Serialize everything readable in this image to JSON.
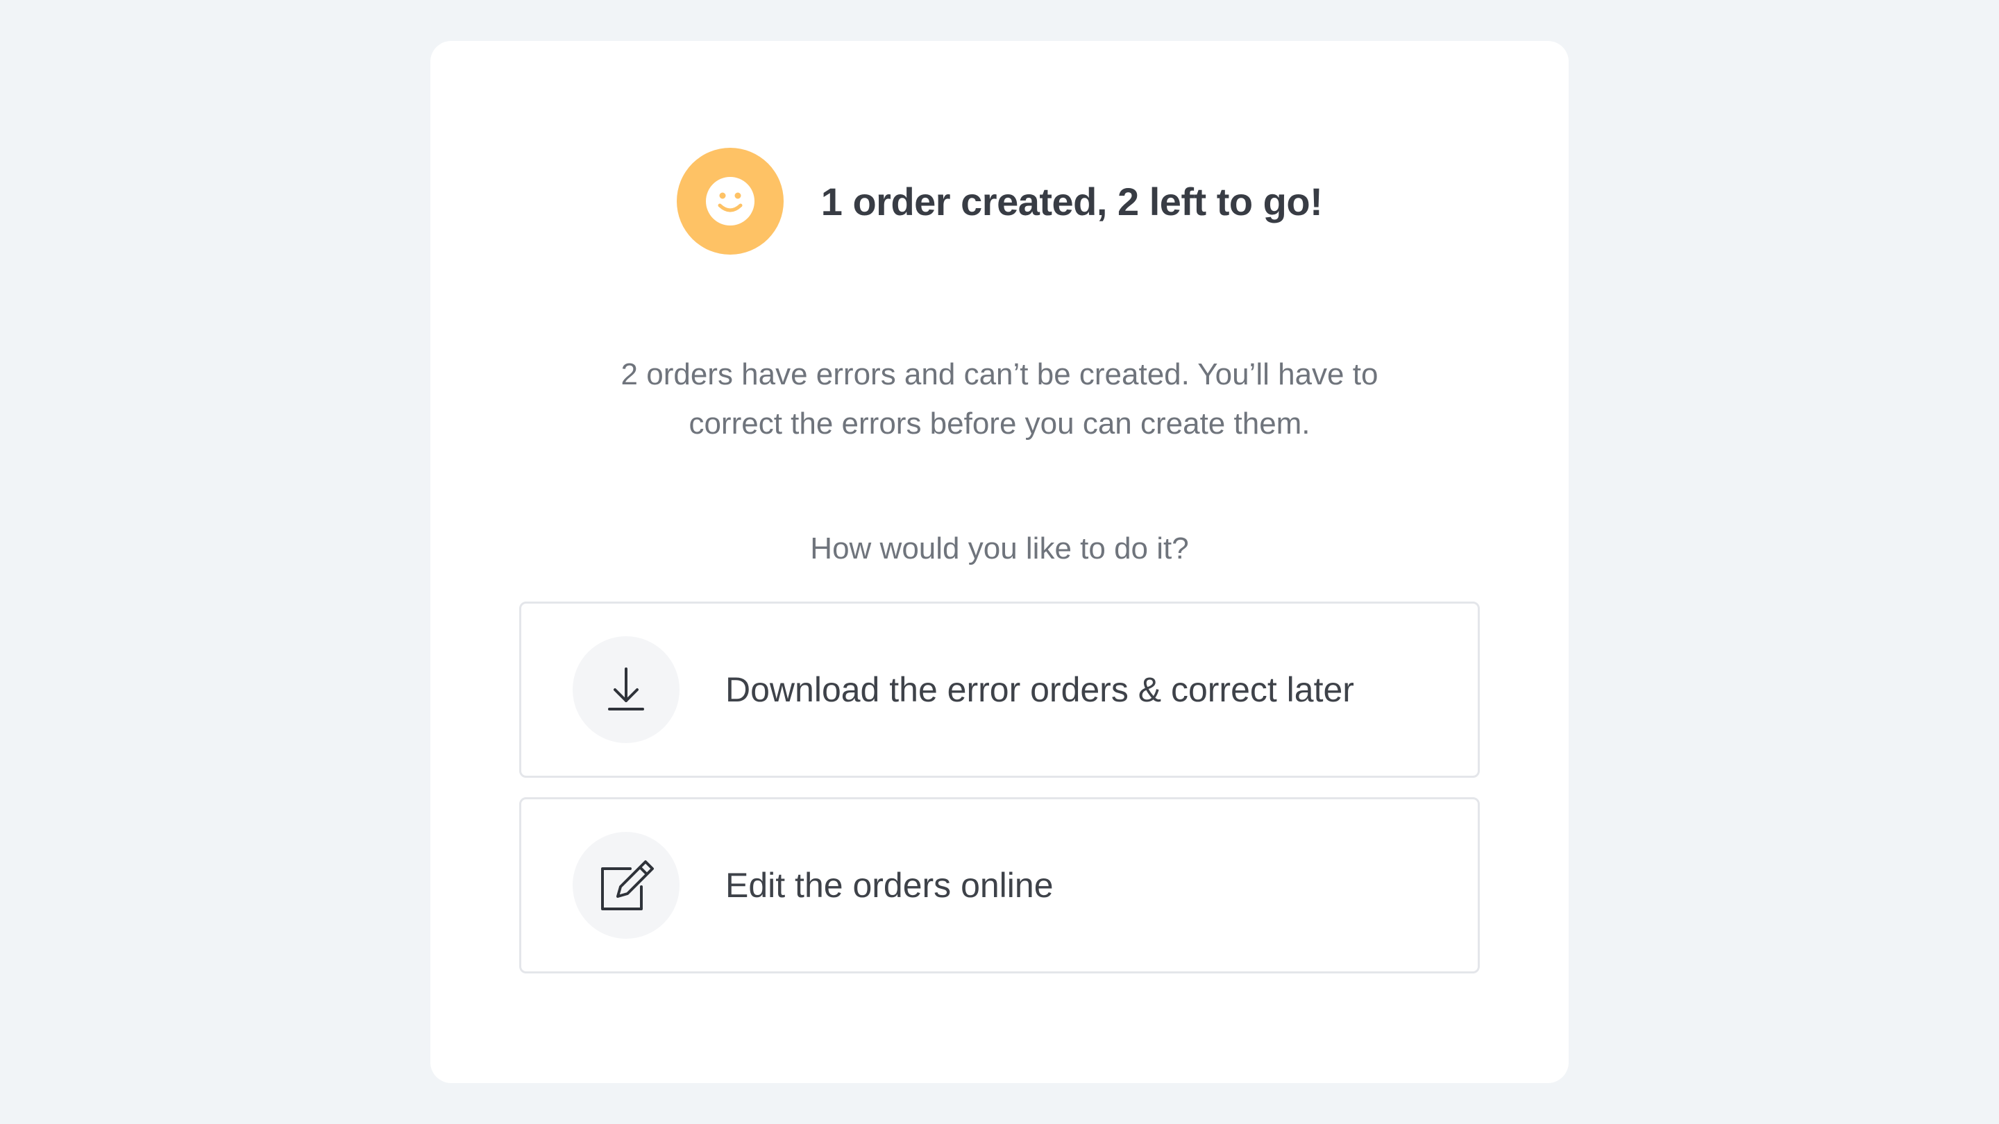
{
  "modal": {
    "title": "1 order created, 2 left to go!",
    "status_icon": "smiley-face-icon",
    "description": "2 orders have errors and can’t be created. You’ll have to correct the errors before you can create them.",
    "question": "How would you like to do it?",
    "options": [
      {
        "icon": "download-icon",
        "label": "Download the error orders & correct later"
      },
      {
        "icon": "edit-icon",
        "label": "Edit the orders online"
      }
    ]
  },
  "colors": {
    "background": "#f1f4f7",
    "accent": "#fec265",
    "title_text": "#383c44",
    "body_text": "#6f747c",
    "option_border": "#e4e6ea",
    "icon_circle": "#f4f5f7"
  }
}
